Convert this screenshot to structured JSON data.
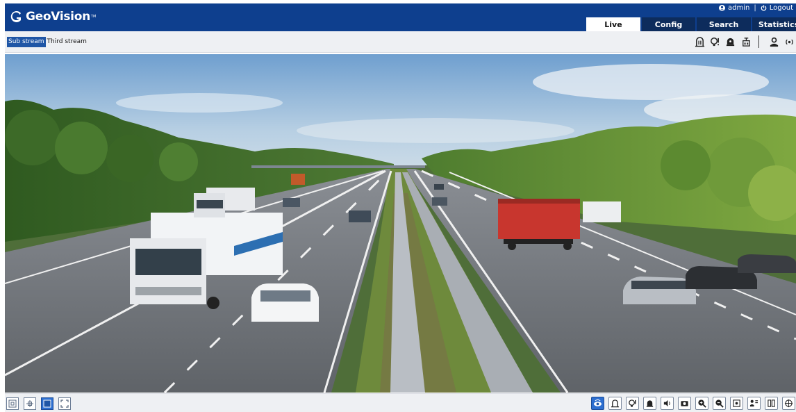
{
  "brand": {
    "name": "GeoVision",
    "tm": "TM",
    "color": "#0e3f8e"
  },
  "user": {
    "icon": "user-icon",
    "name": "admin",
    "separator": "|",
    "logout_icon": "power-icon",
    "logout_label": "Logout"
  },
  "tabs": [
    {
      "label": "Live",
      "active": true
    },
    {
      "label": "Config",
      "active": false
    },
    {
      "label": "Search",
      "active": false
    },
    {
      "label": "Statistics",
      "active": false
    }
  ],
  "streams": [
    {
      "label": "Sub stream",
      "active": true
    },
    {
      "label": "Third stream",
      "active": false
    }
  ],
  "top_icons": [
    "alarm-input-icon",
    "alarm-output-icon",
    "alarm-bell-icon",
    "network-icon",
    "person-icon",
    "wireless-icon"
  ],
  "left_tools": [
    {
      "icon": "fit-icon",
      "active": false
    },
    {
      "icon": "move-icon",
      "active": false
    },
    {
      "icon": "window-icon",
      "active": true
    },
    {
      "icon": "fullscreen-icon",
      "active": false
    }
  ],
  "right_tools": [
    {
      "icon": "eye-icon",
      "active": true
    },
    {
      "icon": "alarm-input-icon",
      "active": false
    },
    {
      "icon": "alarm-output-icon",
      "active": false
    },
    {
      "icon": "alarm-bell-icon",
      "active": false
    },
    {
      "icon": "speaker-icon",
      "active": false
    },
    {
      "icon": "snapshot-icon",
      "active": false
    },
    {
      "icon": "zoom-in-icon",
      "active": false
    },
    {
      "icon": "zoom-out-icon",
      "active": false
    },
    {
      "icon": "focus-icon",
      "active": false
    },
    {
      "icon": "ptz-icon",
      "active": false
    },
    {
      "icon": "layout-icon",
      "active": false
    },
    {
      "icon": "target-icon",
      "active": false
    }
  ]
}
